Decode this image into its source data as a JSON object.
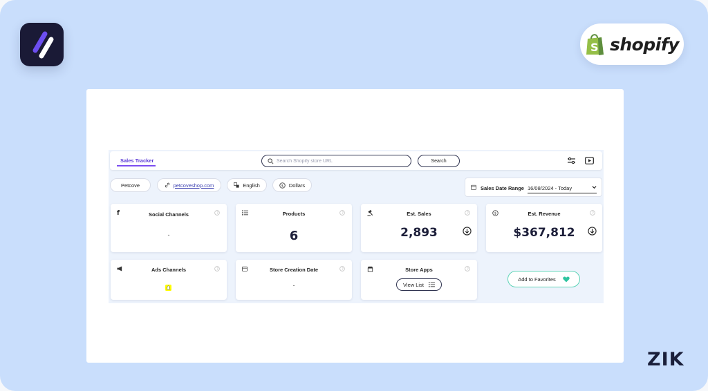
{
  "branding": {
    "app_logo_icon": "zik-slash-logo-icon",
    "shopify_word": "shopify",
    "shopify_icon": "shopify-bag-icon",
    "zik_text": "ZIK"
  },
  "toolbar": {
    "active_tab": "Sales Tracker",
    "search_placeholder": "Search Shopify store URL",
    "search_button": "Search",
    "filter_icon": "sliders-icon",
    "video_icon": "play-icon"
  },
  "store": {
    "name": "Petcove",
    "url": "petcoveshop.com",
    "language": "English",
    "currency": "Dollars"
  },
  "date_range": {
    "label": "Sales Date Range",
    "value": "16/08/2024 - Today"
  },
  "tiles": {
    "social": {
      "title": "Social Channels",
      "value": "-"
    },
    "products": {
      "title": "Products",
      "value": "6"
    },
    "sales": {
      "title": "Est. Sales",
      "value": "2,893"
    },
    "revenue": {
      "title": "Est. Revenue",
      "value": "$367,812"
    },
    "ads": {
      "title": "Ads Channels"
    },
    "creation": {
      "title": "Store Creation Date",
      "value": "-"
    },
    "apps": {
      "title": "Store Apps",
      "button": "View List"
    }
  },
  "favorites_button": "Add to Favorites",
  "colors": {
    "frame_bg": "#c9defc",
    "accent_purple": "#5a39d6",
    "favorite_green": "#2ec4a0",
    "snapchat_yellow": "#fffc00"
  }
}
